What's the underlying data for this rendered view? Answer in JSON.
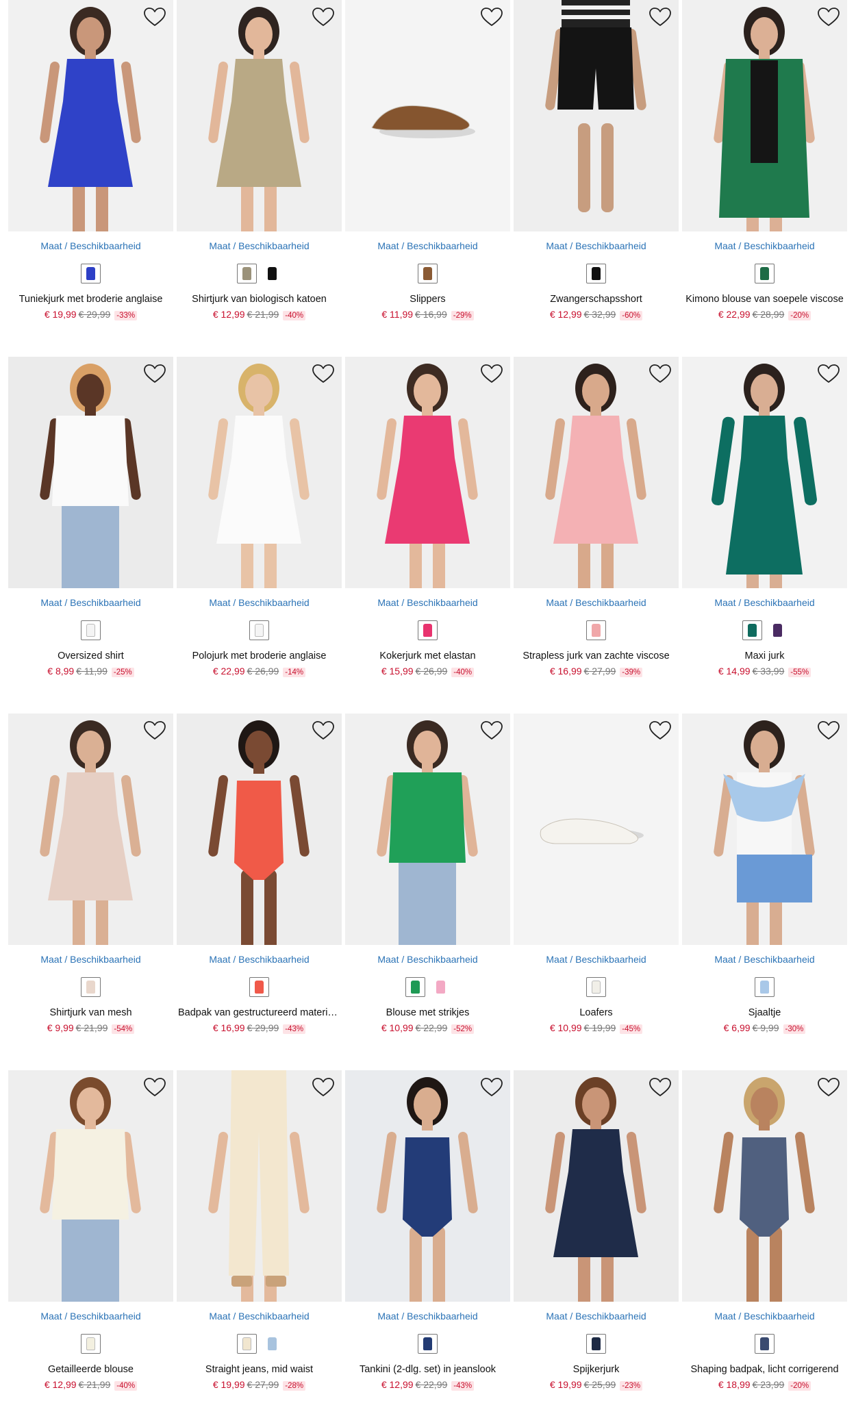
{
  "common": {
    "availability_label": "Maat / Beschikbaarheid"
  },
  "products": [
    {
      "title": "Tuniekjurk met broderie anglaise",
      "price": "€ 19,99",
      "old_price": "€ 29,99",
      "discount": "-33%",
      "swatches": [
        "#2d3fc6"
      ],
      "garment_color": "#2f42c8",
      "skin": "#c9977a",
      "hair": "#3b2a22",
      "type": "dress",
      "bg": "#f1f1f1"
    },
    {
      "title": "Shirtjurk van biologisch katoen",
      "price": "€ 12,99",
      "old_price": "€ 21,99",
      "discount": "-40%",
      "swatches": [
        "#9b927a",
        "#111111"
      ],
      "garment_color": "#b9a985",
      "skin": "#e2b79a",
      "hair": "#2e2420",
      "type": "dress",
      "bg": "#efefef"
    },
    {
      "title": "Slippers",
      "price": "€ 11,99",
      "old_price": "€ 16,99",
      "discount": "-29%",
      "swatches": [
        "#8a5a34"
      ],
      "garment_color": "#85552f",
      "skin": "",
      "hair": "",
      "type": "shoe",
      "bg": "#f4f4f4"
    },
    {
      "title": "Zwangerschapsshort",
      "price": "€ 12,99",
      "old_price": "€ 32,99",
      "discount": "-60%",
      "swatches": [
        "#111111"
      ],
      "garment_color": "#141414",
      "skin": "#c79d7f",
      "hair": "",
      "type": "shorts",
      "bg": "#eeeeee"
    },
    {
      "title": "Kimono blouse van soepele viscose",
      "price": "€ 22,99",
      "old_price": "€ 28,99",
      "discount": "-20%",
      "swatches": [
        "#1d6b45"
      ],
      "garment_color": "#1f7a4d",
      "skin": "#dcb095",
      "hair": "#2b211d",
      "type": "kimono",
      "bg": "#f0f0f0"
    },
    {
      "title": "Oversized shirt",
      "price": "€ 8,99",
      "old_price": "€ 11,99",
      "discount": "-25%",
      "swatches": [
        "#f4f4f4"
      ],
      "garment_color": "#fafafa",
      "skin": "#5a3626",
      "hair": "#d9a066",
      "type": "top",
      "bg": "#ebebeb"
    },
    {
      "title": "Polojurk met broderie anglaise",
      "price": "€ 22,99",
      "old_price": "€ 26,99",
      "discount": "-14%",
      "swatches": [
        "#f5f5f5"
      ],
      "garment_color": "#fbfbfb",
      "skin": "#e8c3a6",
      "hair": "#d8b36a",
      "type": "dress",
      "bg": "#eeeeee"
    },
    {
      "title": "Kokerjurk met elastan",
      "price": "€ 15,99",
      "old_price": "€ 26,99",
      "discount": "-40%",
      "swatches": [
        "#e8336e"
      ],
      "garment_color": "#ea3a72",
      "skin": "#e3b89b",
      "hair": "#3d2b22",
      "type": "dress",
      "bg": "#efefef"
    },
    {
      "title": "Strapless jurk van zachte viscose",
      "price": "€ 16,99",
      "old_price": "€ 27,99",
      "discount": "-39%",
      "swatches": [
        "#f0a7a9"
      ],
      "garment_color": "#f4b1b4",
      "skin": "#d8a98b",
      "hair": "#2d211c",
      "type": "dress",
      "bg": "#eeeeee"
    },
    {
      "title": "Maxi jurk",
      "price": "€ 14,99",
      "old_price": "€ 33,99",
      "discount": "-55%",
      "swatches": [
        "#0f6b5e",
        "#4a2b62"
      ],
      "garment_color": "#0d6e61",
      "skin": "#d9ae93",
      "hair": "#2b211d",
      "type": "maxi",
      "bg": "#f2f2f2"
    },
    {
      "title": "Shirtjurk van mesh",
      "price": "€ 9,99",
      "old_price": "€ 21,99",
      "discount": "-54%",
      "swatches": [
        "#e9d7cc"
      ],
      "garment_color": "#e6cfc4",
      "skin": "#dab094",
      "hair": "#3a2a22",
      "type": "dress",
      "bg": "#efefef"
    },
    {
      "title": "Badpak van gestructureerd materiaal",
      "price": "€ 16,99",
      "old_price": "€ 29,99",
      "discount": "-43%",
      "swatches": [
        "#f0594a"
      ],
      "garment_color": "#f05a48",
      "skin": "#7a4a33",
      "hair": "#1f1714",
      "type": "swim",
      "bg": "#ededed"
    },
    {
      "title": "Blouse met strikjes",
      "price": "€ 10,99",
      "old_price": "€ 22,99",
      "discount": "-52%",
      "swatches": [
        "#1f9a55",
        "#f3a9c4"
      ],
      "garment_color": "#20a058",
      "skin": "#e0b498",
      "hair": "#3a2a22",
      "type": "top",
      "bg": "#f0f0f0"
    },
    {
      "title": "Loafers",
      "price": "€ 10,99",
      "old_price": "€ 19,99",
      "discount": "-45%",
      "swatches": [
        "#f1efe8"
      ],
      "garment_color": "#f5f3ee",
      "skin": "",
      "hair": "",
      "type": "shoe",
      "bg": "#f4f4f4"
    },
    {
      "title": "Sjaaltje",
      "price": "€ 6,99",
      "old_price": "€ 9,99",
      "discount": "-30%",
      "swatches": [
        "#a9c8e8"
      ],
      "garment_color": "#a8c9ea",
      "skin": "#d8ad91",
      "hair": "#2d221d",
      "type": "scarf",
      "bg": "#f1f1f1"
    },
    {
      "title": "Getailleerde blouse",
      "price": "€ 12,99",
      "old_price": "€ 21,99",
      "discount": "-40%",
      "swatches": [
        "#f3f0e0"
      ],
      "garment_color": "#f5f1e2",
      "skin": "#e3b99c",
      "hair": "#7a4b2d",
      "type": "top",
      "bg": "#eeeeee"
    },
    {
      "title": "Straight jeans, mid waist",
      "price": "€ 19,99",
      "old_price": "€ 27,99",
      "discount": "-28%",
      "swatches": [
        "#f1e6cf",
        "#a8c3de"
      ],
      "garment_color": "#f3e7cf",
      "skin": "#e3b99c",
      "hair": "",
      "type": "pants",
      "bg": "#eeeeee"
    },
    {
      "title": "Tankini (2-dlg. set) in jeanslook",
      "price": "€ 12,99",
      "old_price": "€ 22,99",
      "discount": "-43%",
      "swatches": [
        "#233b73"
      ],
      "garment_color": "#233c78",
      "skin": "#d9ad8f",
      "hair": "#1f1714",
      "type": "swim",
      "bg": "#e9ebee"
    },
    {
      "title": "Spijkerjurk",
      "price": "€ 19,99",
      "old_price": "€ 25,99",
      "discount": "-23%",
      "swatches": [
        "#1d2a45"
      ],
      "garment_color": "#1f2c49",
      "skin": "#c99577",
      "hair": "#6b4026",
      "type": "dress",
      "bg": "#ececec"
    },
    {
      "title": "Shaping badpak, licht corrigerend",
      "price": "€ 18,99",
      "old_price": "€ 23,99",
      "discount": "-20%",
      "swatches": [
        "#3a4a70"
      ],
      "garment_color": "#50607f",
      "skin": "#b9835f",
      "hair": "#c9a56d",
      "type": "swim",
      "bg": "#f0f0f0"
    }
  ]
}
